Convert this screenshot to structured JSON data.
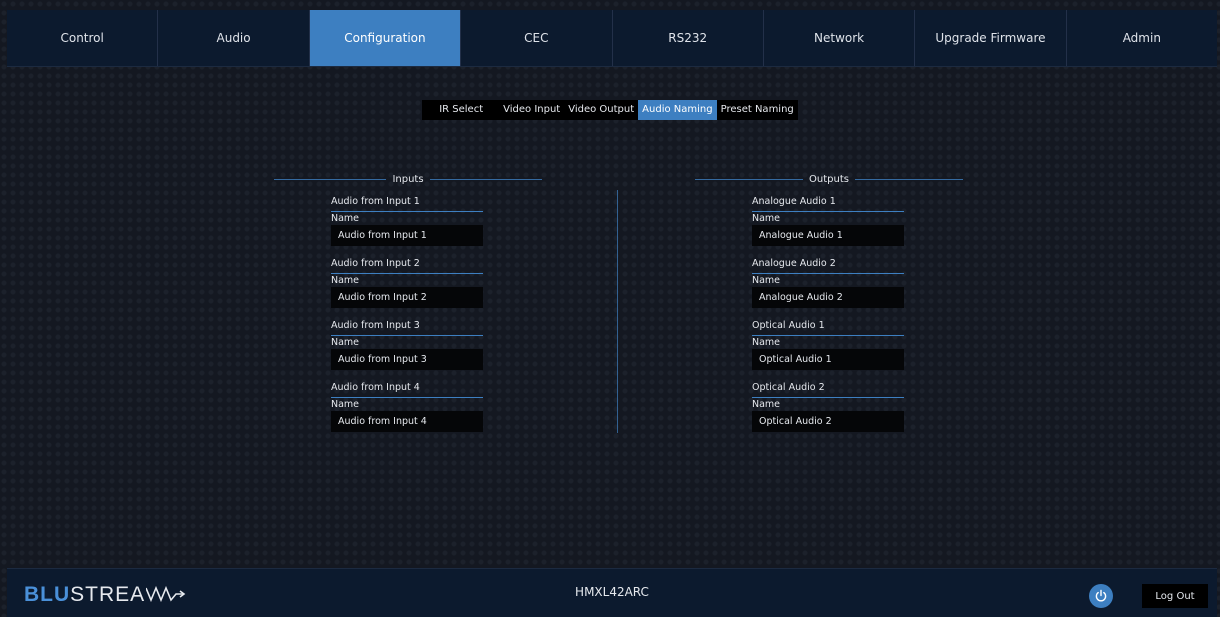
{
  "nav": {
    "tabs": [
      {
        "label": "Control"
      },
      {
        "label": "Audio"
      },
      {
        "label": "Configuration"
      },
      {
        "label": "CEC"
      },
      {
        "label": "RS232"
      },
      {
        "label": "Network"
      },
      {
        "label": "Upgrade Firmware"
      },
      {
        "label": "Admin"
      }
    ],
    "active_tab": "Configuration"
  },
  "subtabs": {
    "items": [
      {
        "label": "IR Select"
      },
      {
        "label": "Video Input"
      },
      {
        "label": "Video Output"
      },
      {
        "label": "Audio Naming"
      },
      {
        "label": "Preset Naming"
      }
    ],
    "active": "Audio Naming"
  },
  "inputs": {
    "title": "Inputs",
    "entries": [
      {
        "heading": "Audio from Input 1",
        "label": "Name",
        "value": "Audio from Input 1"
      },
      {
        "heading": "Audio from Input 2",
        "label": "Name",
        "value": "Audio from Input 2"
      },
      {
        "heading": "Audio from Input 3",
        "label": "Name",
        "value": "Audio from Input 3"
      },
      {
        "heading": "Audio from Input 4",
        "label": "Name",
        "value": "Audio from Input 4"
      }
    ]
  },
  "outputs": {
    "title": "Outputs",
    "entries": [
      {
        "heading": "Analogue Audio 1",
        "label": "Name",
        "value": "Analogue Audio 1"
      },
      {
        "heading": "Analogue Audio 2",
        "label": "Name",
        "value": "Analogue Audio 2"
      },
      {
        "heading": "Optical Audio 1",
        "label": "Name",
        "value": "Optical Audio 1"
      },
      {
        "heading": "Optical Audio 2",
        "label": "Name",
        "value": "Optical Audio 2"
      }
    ]
  },
  "footer": {
    "logo": {
      "part1": "BLU",
      "part2": "STREA"
    },
    "device_name": "HMXL42ARC",
    "power_icon": "power-icon",
    "logout_label": "Log Out"
  },
  "colors": {
    "accent": "#3d7fc1",
    "bar_background": "#0c1a2e",
    "page_background": "#141821",
    "field_background": "#050608"
  }
}
